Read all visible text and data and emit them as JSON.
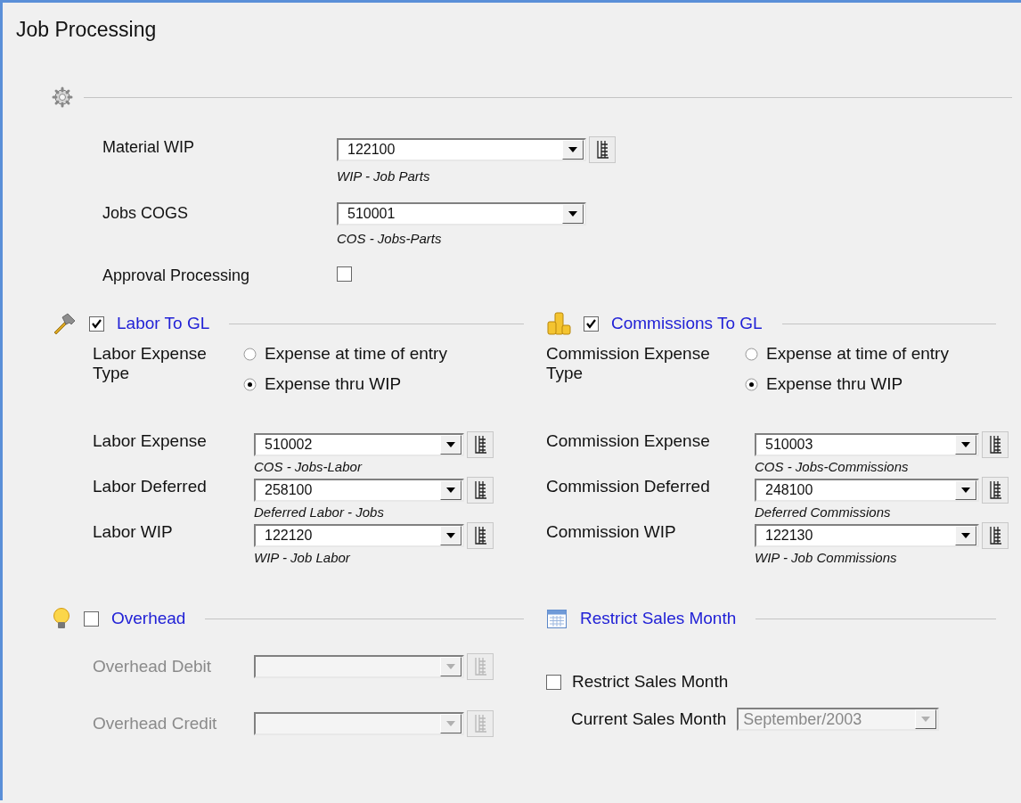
{
  "window": {
    "title": "Job Processing"
  },
  "general": {
    "fields": [
      {
        "label": "Material WIP",
        "value": "122100",
        "description": "WIP - Job Parts",
        "lookup": true
      },
      {
        "label": "Jobs COGS",
        "value": "510001",
        "description": "COS - Jobs-Parts",
        "lookup": false
      }
    ],
    "approval": {
      "label": "Approval Processing",
      "checked": false
    }
  },
  "sections": [
    {
      "kind": "accounts",
      "title": "Labor To GL",
      "checked": true,
      "disabled": false,
      "expense_type": {
        "label": "Labor Expense Type",
        "options": [
          {
            "label": "Expense at time of entry",
            "selected": false
          },
          {
            "label": "Expense thru WIP",
            "selected": true
          }
        ]
      },
      "accounts": [
        {
          "label": "Labor Expense",
          "value": "510002",
          "description": "COS - Jobs-Labor"
        },
        {
          "label": "Labor Deferred",
          "value": "258100",
          "description": "Deferred Labor - Jobs"
        },
        {
          "label": "Labor WIP",
          "value": "122120",
          "description": "WIP - Job Labor"
        }
      ]
    },
    {
      "kind": "accounts",
      "title": "Commissions To GL",
      "checked": true,
      "disabled": false,
      "expense_type": {
        "label": "Commission Expense Type",
        "options": [
          {
            "label": "Expense at time of entry",
            "selected": false
          },
          {
            "label": "Expense thru WIP",
            "selected": true
          }
        ]
      },
      "accounts": [
        {
          "label": "Commission Expense",
          "value": "510003",
          "description": "COS - Jobs-Commissions"
        },
        {
          "label": "Commission Deferred",
          "value": "248100",
          "description": "Deferred Commissions"
        },
        {
          "label": "Commission WIP",
          "value": "122130",
          "description": "WIP - Job Commissions"
        }
      ]
    },
    {
      "kind": "accounts",
      "title": "Overhead",
      "checked": false,
      "disabled": true,
      "accounts": [
        {
          "label": "Overhead Debit"
        },
        {
          "label": "Overhead Credit"
        }
      ]
    },
    {
      "kind": "month",
      "title": "Restrict Sales Month",
      "restrict": {
        "label": "Restrict Sales Month",
        "checked": false
      },
      "current_month": {
        "label": "Current Sales Month",
        "value": "September/2003",
        "disabled": true
      }
    }
  ]
}
